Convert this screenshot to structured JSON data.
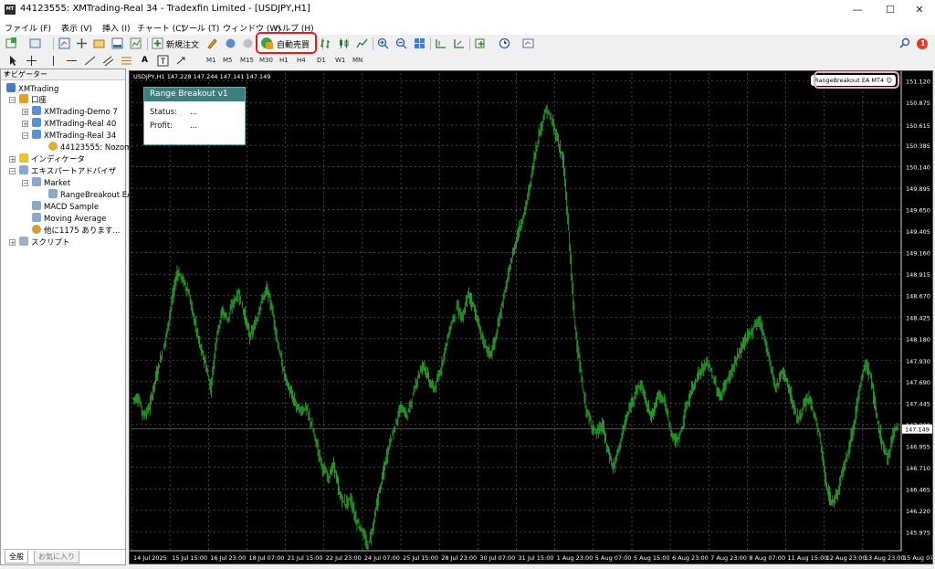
{
  "window": {
    "title": "44123555: XMTrading-Real 34 - Tradexfin Limited - [USDJPY,H1]",
    "app_icon_text": "MT",
    "minimize": "—",
    "maximize": "☐",
    "close": "✕"
  },
  "menu": [
    "ファイル (F)",
    "表示 (V)",
    "挿入 (I)",
    "チャート (C)",
    "ツール (T)",
    "ウィンドウ (W)",
    "ヘルプ (H)"
  ],
  "toolbar": {
    "new_order_label": "新規注文",
    "auto_trade_label": "自動売買",
    "notification_count": "1"
  },
  "timeframes": [
    "M1",
    "M5",
    "M15",
    "M30",
    "H1",
    "H4",
    "D1",
    "W1",
    "MN"
  ],
  "navigator": {
    "title": "ナビゲーター",
    "close": "×",
    "items": [
      "XMTrading",
      "口座",
      "XMTrading-Demo 7",
      "XMTrading-Real 40",
      "XMTrading-Real 34",
      "44123555: Nozomu",
      "インディケータ",
      "エキスパートアドバイザ",
      "Market",
      "RangeBreakout EA",
      "MACD Sample",
      "Moving Average",
      "他に1175 あります...",
      "スクリプト"
    ],
    "tabs": [
      "全般",
      "お気に入り"
    ]
  },
  "chart": {
    "info_line": "USDJPY,H1  147.228 147.244 147.141 147.149",
    "ea_label": "RangeBreakout EA  MT4 ☺",
    "current_price": "147.149",
    "panel": {
      "title": "Range Breakout v1",
      "status_label": "Status:",
      "status_value": "...",
      "profit_label": "Profit:",
      "profit_value": "..."
    }
  },
  "chart_data": {
    "type": "bar",
    "symbol": "USDJPY",
    "timeframe": "H1",
    "title": "USDJPY,H1",
    "candle_color": "#2aa52a",
    "background": "#000000",
    "grid": true,
    "ylim": [
      145.76,
      151.21
    ],
    "y_ticks": [
      "151.120",
      "150.875",
      "150.615",
      "150.385",
      "150.140",
      "149.895",
      "149.650",
      "149.405",
      "149.160",
      "148.915",
      "148.670",
      "148.425",
      "148.180",
      "147.930",
      "147.690",
      "147.445",
      "147.200",
      "146.955",
      "146.710",
      "146.465",
      "146.220",
      "145.975",
      "145.730"
    ],
    "x_ticks": [
      "14 Jul 2025",
      "15 Jul 15:00",
      "16 Jul 23:00",
      "18 Jul 07:00",
      "21 Jul 15:00",
      "22 Jul 23:00",
      "24 Jul 07:00",
      "25 Jul 15:00",
      "28 Jul 23:00",
      "30 Jul 07:00",
      "31 Jul 15:00",
      "1 Aug 23:00",
      "5 Aug 07:00",
      "5 Aug 15:00",
      "6 Aug 23:00",
      "7 Aug 23:00",
      "8 Aug 07:00",
      "11 Aug 15:00",
      "12 Aug 23:00",
      "13 Aug 23:00",
      "15 Aug 07:00"
    ],
    "series": [
      {
        "values": [
          147.5,
          147.3,
          147.4,
          147.7,
          147.95,
          148.2,
          148.6,
          148.95,
          148.85,
          148.7,
          148.4,
          148.1,
          147.9,
          147.6,
          148.2,
          148.5,
          148.4,
          148.6,
          148.7,
          148.45,
          148.2,
          148.35,
          148.6,
          148.75,
          148.5,
          148.1,
          147.8,
          147.6,
          147.45,
          147.35,
          147.4,
          147.2,
          146.95,
          146.7,
          146.6,
          146.75,
          146.4,
          146.3,
          146.35,
          146.1,
          146.0,
          145.8,
          146.05,
          146.4,
          146.7,
          147.0,
          147.2,
          147.4,
          147.3,
          147.5,
          147.75,
          147.9,
          147.7,
          147.6,
          147.8,
          148.1,
          148.35,
          148.55,
          148.4,
          148.7,
          148.55,
          148.3,
          148.1,
          148.0,
          148.2,
          148.55,
          148.85,
          149.15,
          149.4,
          149.6,
          149.9,
          150.3,
          150.6,
          150.8,
          150.65,
          150.45,
          150.2,
          149.4,
          148.4,
          147.85,
          147.4,
          147.2,
          147.1,
          147.2,
          146.9,
          146.7,
          146.95,
          147.2,
          147.4,
          147.6,
          147.65,
          147.4,
          147.3,
          147.55,
          147.5,
          147.2,
          147.0,
          147.1,
          147.4,
          147.6,
          147.75,
          147.85,
          147.9,
          147.7,
          147.5,
          147.65,
          147.8,
          147.95,
          148.1,
          148.2,
          148.3,
          148.4,
          148.2,
          147.9,
          147.6,
          147.8,
          147.7,
          147.45,
          147.25,
          147.4,
          147.5,
          147.3,
          147.0,
          146.5,
          146.3,
          146.4,
          146.7,
          146.9,
          147.2,
          147.6,
          147.9,
          147.75,
          147.3,
          147.0,
          146.8,
          147.1,
          147.2
        ]
      }
    ]
  }
}
